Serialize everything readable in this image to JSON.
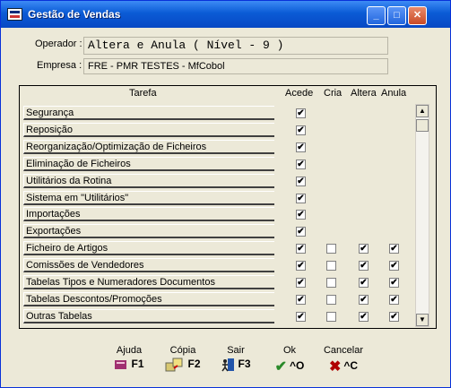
{
  "window": {
    "title": "Gestão de Vendas"
  },
  "form": {
    "operador_label": "Operador :",
    "operador_value": "Altera e Anula ( Nível - 9 )",
    "empresa_label": "Empresa :",
    "empresa_value": "FRE - PMR TESTES - MfCobol"
  },
  "table": {
    "columns": [
      "Tarefa",
      "Acede",
      "Cria",
      "Altera",
      "Anula"
    ],
    "rows": [
      {
        "tarefa": "Segurança",
        "acede": true,
        "cria": null,
        "altera": null,
        "anula": null
      },
      {
        "tarefa": "Reposição",
        "acede": true,
        "cria": null,
        "altera": null,
        "anula": null
      },
      {
        "tarefa": "Reorganização/Optimização de Ficheiros",
        "acede": true,
        "cria": null,
        "altera": null,
        "anula": null
      },
      {
        "tarefa": "Eliminação de Ficheiros",
        "acede": true,
        "cria": null,
        "altera": null,
        "anula": null
      },
      {
        "tarefa": "Utilitários da Rotina",
        "acede": true,
        "cria": null,
        "altera": null,
        "anula": null
      },
      {
        "tarefa": "Sistema em \"Utilitários\"",
        "acede": true,
        "cria": null,
        "altera": null,
        "anula": null
      },
      {
        "tarefa": "Importações",
        "acede": true,
        "cria": null,
        "altera": null,
        "anula": null
      },
      {
        "tarefa": "Exportações",
        "acede": true,
        "cria": null,
        "altera": null,
        "anula": null
      },
      {
        "tarefa": "Ficheiro de Artigos",
        "acede": true,
        "cria": false,
        "altera": true,
        "anula": true
      },
      {
        "tarefa": "Comissões de Vendedores",
        "acede": true,
        "cria": false,
        "altera": true,
        "anula": true
      },
      {
        "tarefa": "Tabelas Tipos e Numeradores Documentos",
        "acede": true,
        "cria": false,
        "altera": true,
        "anula": true
      },
      {
        "tarefa": "Tabelas Descontos/Promoções",
        "acede": true,
        "cria": false,
        "altera": true,
        "anula": true
      },
      {
        "tarefa": "Outras Tabelas",
        "acede": true,
        "cria": false,
        "altera": true,
        "anula": true
      }
    ]
  },
  "footer": [
    {
      "label": "Ajuda",
      "key": "F1",
      "icon": "book-icon"
    },
    {
      "label": "Cópia",
      "key": "F2",
      "icon": "copy-icon"
    },
    {
      "label": "Sair",
      "key": "F3",
      "icon": "exit-icon"
    },
    {
      "label": "Ok",
      "key": "^O",
      "icon": "checkmark-icon"
    },
    {
      "label": "Cancelar",
      "key": "^C",
      "icon": "cancel-x-icon"
    }
  ],
  "colors": {
    "titlebar": "#0a5bd5",
    "window_bg": "#ece9d8",
    "check": "#000000",
    "ok_icon": "#2a8a2a",
    "cancel_icon": "#b00000"
  }
}
